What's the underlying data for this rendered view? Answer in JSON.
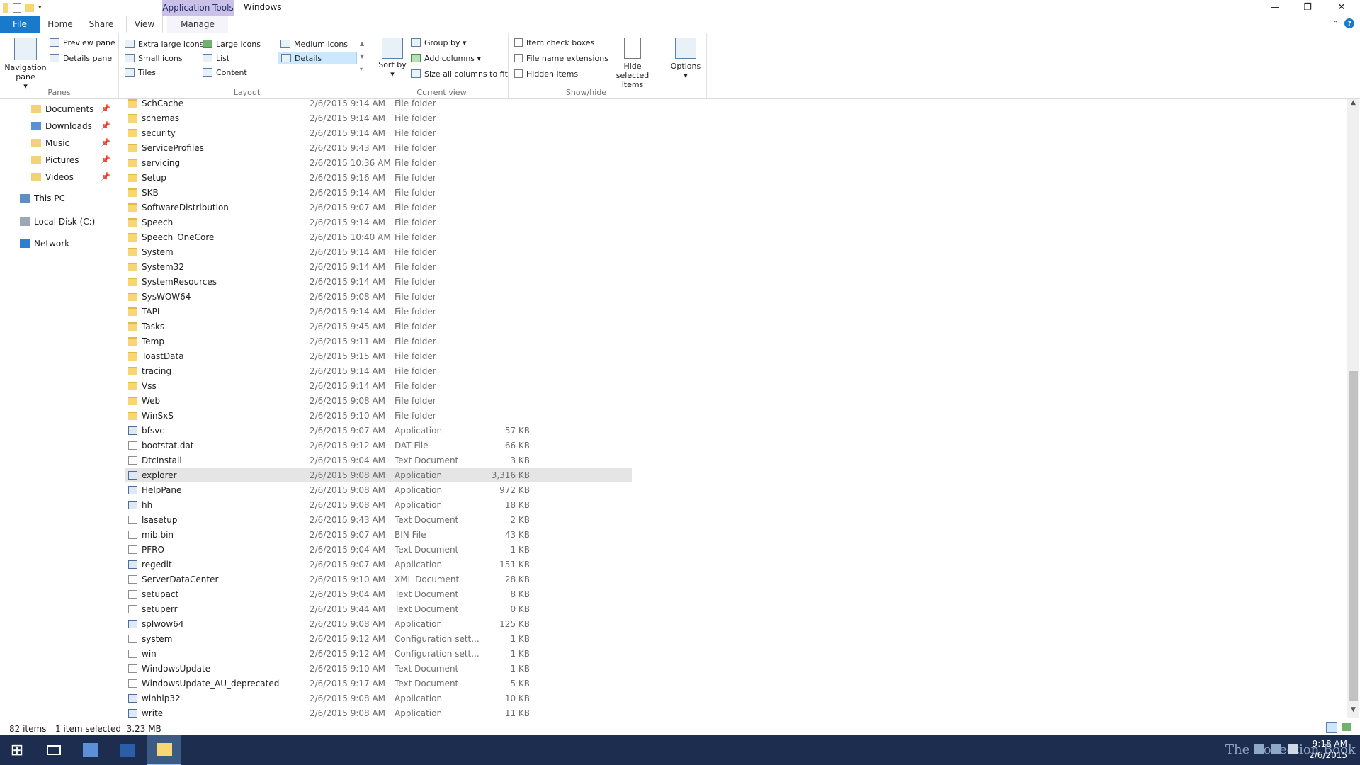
{
  "window": {
    "context_tab_label": "Application Tools",
    "title": "Windows",
    "minimize": "—",
    "restore": "❐",
    "close": "✕"
  },
  "tabs": {
    "file": "File",
    "home": "Home",
    "share": "Share",
    "view": "View",
    "manage": "Manage"
  },
  "ribbon": {
    "panes": {
      "navigation_pane": "Navigation pane",
      "preview_pane": "Preview pane",
      "details_pane": "Details pane",
      "label": "Panes"
    },
    "layout": {
      "extra_large_icons": "Extra large icons",
      "large_icons": "Large icons",
      "medium_icons": "Medium icons",
      "small_icons": "Small icons",
      "list": "List",
      "details": "Details",
      "tiles": "Tiles",
      "content": "Content",
      "label": "Layout"
    },
    "current_view": {
      "sort_by": "Sort by",
      "group_by": "Group by ▾",
      "add_columns": "Add columns ▾",
      "size_all_columns": "Size all columns to fit",
      "label": "Current view"
    },
    "show_hide": {
      "item_check_boxes": "Item check boxes",
      "file_name_extensions": "File name extensions",
      "hidden_items": "Hidden items",
      "hide_selected_items": "Hide selected items",
      "label": "Show/hide"
    },
    "options": "Options"
  },
  "nav": {
    "documents": "Documents",
    "downloads": "Downloads",
    "music": "Music",
    "pictures": "Pictures",
    "videos": "Videos",
    "this_pc": "This PC",
    "local_disk": "Local Disk (C:)",
    "network": "Network"
  },
  "files": [
    {
      "name": "SchCache",
      "date": "2/6/2015 9:14 AM",
      "type": "File folder",
      "size": "",
      "kind": "folder"
    },
    {
      "name": "schemas",
      "date": "2/6/2015 9:14 AM",
      "type": "File folder",
      "size": "",
      "kind": "folder"
    },
    {
      "name": "security",
      "date": "2/6/2015 9:14 AM",
      "type": "File folder",
      "size": "",
      "kind": "folder"
    },
    {
      "name": "ServiceProfiles",
      "date": "2/6/2015 9:43 AM",
      "type": "File folder",
      "size": "",
      "kind": "folder"
    },
    {
      "name": "servicing",
      "date": "2/6/2015 10:36 AM",
      "type": "File folder",
      "size": "",
      "kind": "folder"
    },
    {
      "name": "Setup",
      "date": "2/6/2015 9:16 AM",
      "type": "File folder",
      "size": "",
      "kind": "folder"
    },
    {
      "name": "SKB",
      "date": "2/6/2015 9:14 AM",
      "type": "File folder",
      "size": "",
      "kind": "folder"
    },
    {
      "name": "SoftwareDistribution",
      "date": "2/6/2015 9:07 AM",
      "type": "File folder",
      "size": "",
      "kind": "folder"
    },
    {
      "name": "Speech",
      "date": "2/6/2015 9:14 AM",
      "type": "File folder",
      "size": "",
      "kind": "folder"
    },
    {
      "name": "Speech_OneCore",
      "date": "2/6/2015 10:40 AM",
      "type": "File folder",
      "size": "",
      "kind": "folder"
    },
    {
      "name": "System",
      "date": "2/6/2015 9:14 AM",
      "type": "File folder",
      "size": "",
      "kind": "folder"
    },
    {
      "name": "System32",
      "date": "2/6/2015 9:14 AM",
      "type": "File folder",
      "size": "",
      "kind": "folder"
    },
    {
      "name": "SystemResources",
      "date": "2/6/2015 9:14 AM",
      "type": "File folder",
      "size": "",
      "kind": "folder"
    },
    {
      "name": "SysWOW64",
      "date": "2/6/2015 9:08 AM",
      "type": "File folder",
      "size": "",
      "kind": "folder"
    },
    {
      "name": "TAPI",
      "date": "2/6/2015 9:14 AM",
      "type": "File folder",
      "size": "",
      "kind": "folder"
    },
    {
      "name": "Tasks",
      "date": "2/6/2015 9:45 AM",
      "type": "File folder",
      "size": "",
      "kind": "folder"
    },
    {
      "name": "Temp",
      "date": "2/6/2015 9:11 AM",
      "type": "File folder",
      "size": "",
      "kind": "folder"
    },
    {
      "name": "ToastData",
      "date": "2/6/2015 9:15 AM",
      "type": "File folder",
      "size": "",
      "kind": "folder"
    },
    {
      "name": "tracing",
      "date": "2/6/2015 9:14 AM",
      "type": "File folder",
      "size": "",
      "kind": "folder"
    },
    {
      "name": "Vss",
      "date": "2/6/2015 9:14 AM",
      "type": "File folder",
      "size": "",
      "kind": "folder"
    },
    {
      "name": "Web",
      "date": "2/6/2015 9:08 AM",
      "type": "File folder",
      "size": "",
      "kind": "folder"
    },
    {
      "name": "WinSxS",
      "date": "2/6/2015 9:10 AM",
      "type": "File folder",
      "size": "",
      "kind": "folder"
    },
    {
      "name": "bfsvc",
      "date": "2/6/2015 9:07 AM",
      "type": "Application",
      "size": "57 KB",
      "kind": "app"
    },
    {
      "name": "bootstat.dat",
      "date": "2/6/2015 9:12 AM",
      "type": "DAT File",
      "size": "66 KB",
      "kind": "file"
    },
    {
      "name": "DtcInstall",
      "date": "2/6/2015 9:04 AM",
      "type": "Text Document",
      "size": "3 KB",
      "kind": "file"
    },
    {
      "name": "explorer",
      "date": "2/6/2015 9:08 AM",
      "type": "Application",
      "size": "3,316 KB",
      "kind": "app",
      "selected": true
    },
    {
      "name": "HelpPane",
      "date": "2/6/2015 9:08 AM",
      "type": "Application",
      "size": "972 KB",
      "kind": "app"
    },
    {
      "name": "hh",
      "date": "2/6/2015 9:08 AM",
      "type": "Application",
      "size": "18 KB",
      "kind": "app"
    },
    {
      "name": "lsasetup",
      "date": "2/6/2015 9:43 AM",
      "type": "Text Document",
      "size": "2 KB",
      "kind": "file"
    },
    {
      "name": "mib.bin",
      "date": "2/6/2015 9:07 AM",
      "type": "BIN File",
      "size": "43 KB",
      "kind": "file"
    },
    {
      "name": "PFRO",
      "date": "2/6/2015 9:04 AM",
      "type": "Text Document",
      "size": "1 KB",
      "kind": "file"
    },
    {
      "name": "regedit",
      "date": "2/6/2015 9:07 AM",
      "type": "Application",
      "size": "151 KB",
      "kind": "app"
    },
    {
      "name": "ServerDataCenter",
      "date": "2/6/2015 9:10 AM",
      "type": "XML Document",
      "size": "28 KB",
      "kind": "file"
    },
    {
      "name": "setupact",
      "date": "2/6/2015 9:04 AM",
      "type": "Text Document",
      "size": "8 KB",
      "kind": "file"
    },
    {
      "name": "setuperr",
      "date": "2/6/2015 9:44 AM",
      "type": "Text Document",
      "size": "0 KB",
      "kind": "file"
    },
    {
      "name": "splwow64",
      "date": "2/6/2015 9:08 AM",
      "type": "Application",
      "size": "125 KB",
      "kind": "app"
    },
    {
      "name": "system",
      "date": "2/6/2015 9:12 AM",
      "type": "Configuration sett...",
      "size": "1 KB",
      "kind": "file"
    },
    {
      "name": "win",
      "date": "2/6/2015 9:12 AM",
      "type": "Configuration sett...",
      "size": "1 KB",
      "kind": "file"
    },
    {
      "name": "WindowsUpdate",
      "date": "2/6/2015 9:10 AM",
      "type": "Text Document",
      "size": "1 KB",
      "kind": "file"
    },
    {
      "name": "WindowsUpdate_AU_deprecated",
      "date": "2/6/2015 9:17 AM",
      "type": "Text Document",
      "size": "5 KB",
      "kind": "file"
    },
    {
      "name": "winhlp32",
      "date": "2/6/2015 9:08 AM",
      "type": "Application",
      "size": "10 KB",
      "kind": "app"
    },
    {
      "name": "write",
      "date": "2/6/2015 9:08 AM",
      "type": "Application",
      "size": "11 KB",
      "kind": "app"
    }
  ],
  "status": {
    "item_count": "82 items",
    "selection": "1 item selected  3.23 MB"
  },
  "taskbar": {
    "time": "9:18 AM",
    "date": "2/6/2015",
    "watermark": "The Collection Book"
  },
  "colors": {
    "accent": "#1979ca",
    "selection": "#e5e5e5",
    "context_tab": "#c9c1e6",
    "taskbar": "#1c2d4f"
  }
}
